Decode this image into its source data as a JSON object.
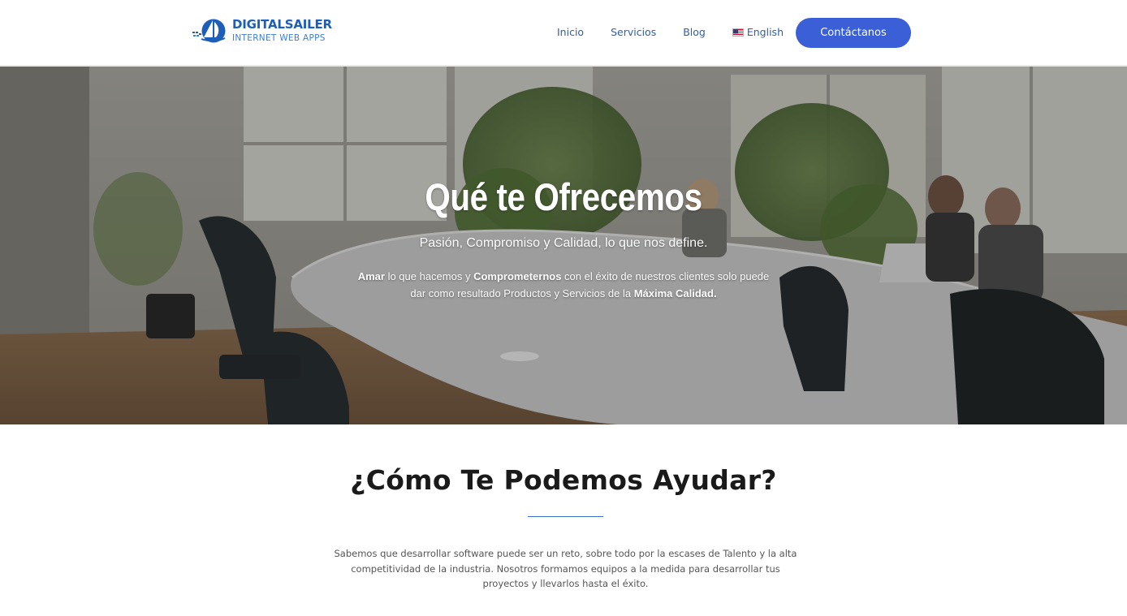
{
  "header": {
    "logo": {
      "name": "DIGITALSAILER",
      "tagline": "INTERNET WEB APPS",
      "icon": "sailboat-logo-icon"
    },
    "nav": [
      {
        "label": "Inicio"
      },
      {
        "label": "Servicios"
      },
      {
        "label": "Blog"
      },
      {
        "label": "English",
        "icon": "us-flag-icon"
      }
    ],
    "contact_button": "Contáctanos"
  },
  "hero": {
    "title": "Qué te Ofrecemos",
    "subtitle": "Pasión, Compromiso y Calidad, lo que nos define.",
    "text": {
      "bold1": "Amar",
      "part1": " lo que hacemos y ",
      "bold2": "Comprometernos",
      "part2": " con el éxito de nuestros clientes solo puede dar como resultado Productos y Servicios de la ",
      "bold3": "Máxima Calidad."
    }
  },
  "help": {
    "title": "¿Cómo Te Podemos Ayudar?",
    "text": "Sabemos que desarrollar software puede ser un reto, sobre todo por la escases de Talento y la alta competitividad de la industria. Nosotros formamos equipos a la medida para desarrollar tus proyectos y llevarlos hasta el éxito."
  },
  "colors": {
    "brand_blue": "#1d5fb8",
    "button_blue": "#3b5fd6",
    "nav_link": "#2c5fae"
  }
}
